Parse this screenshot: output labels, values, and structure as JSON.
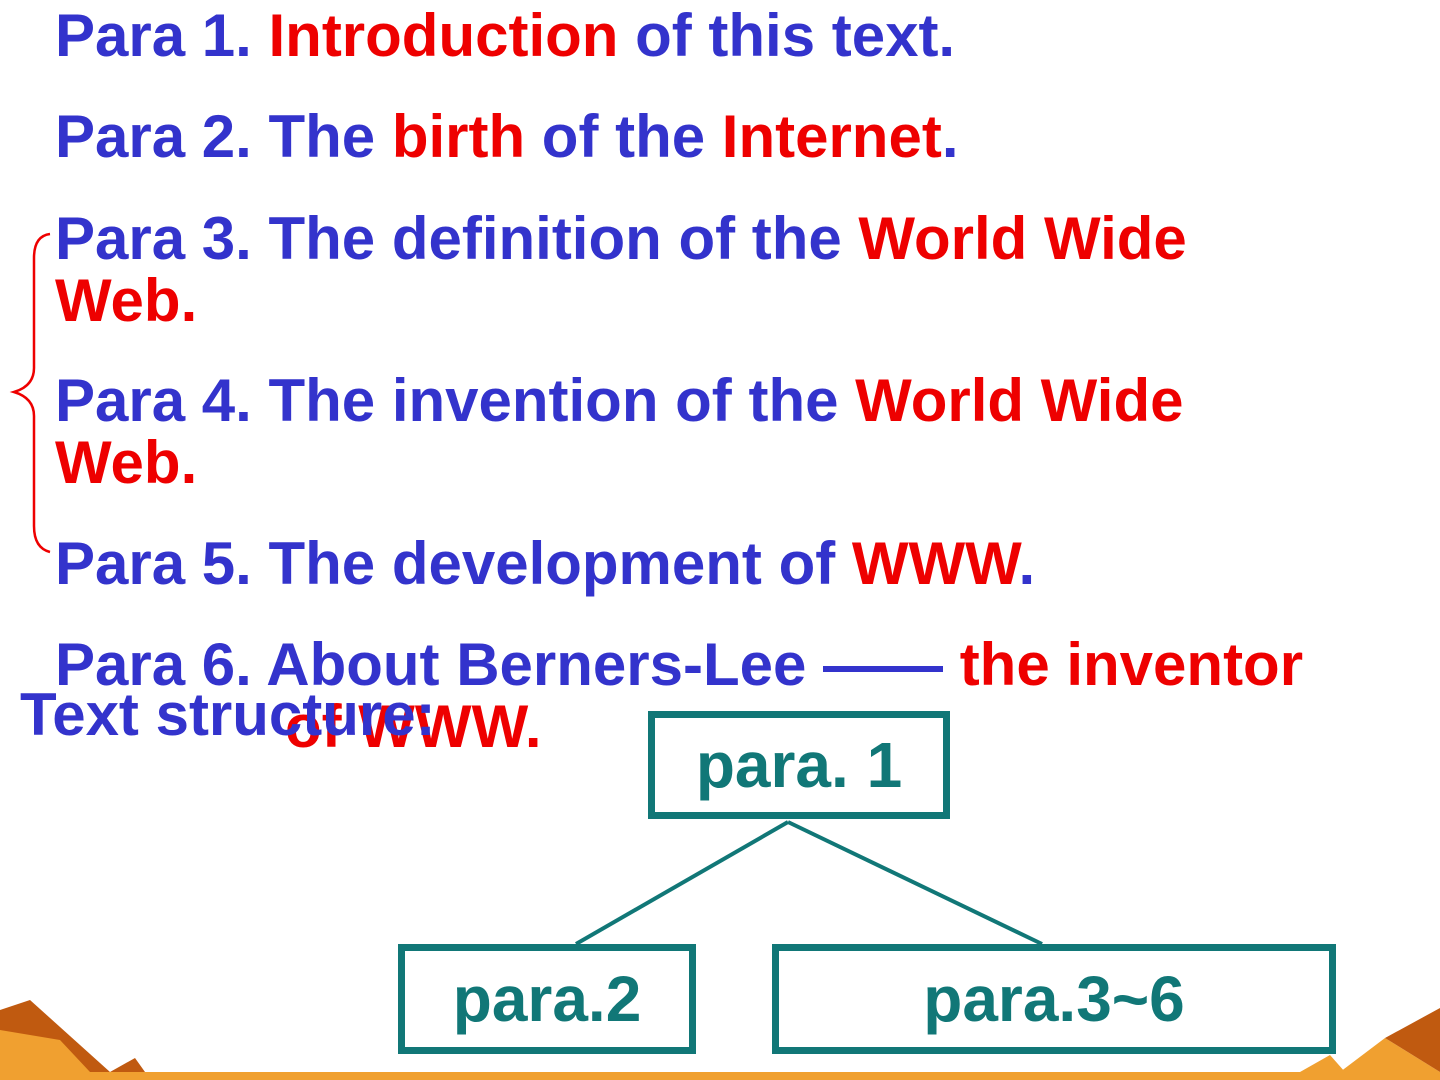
{
  "paragraphs": [
    {
      "id": "p1",
      "segments": [
        {
          "text": "Para 1. ",
          "color": "blue"
        },
        {
          "text": "Introduction",
          "color": "red"
        },
        {
          "text": " of this text.",
          "color": "blue"
        }
      ]
    },
    {
      "id": "p2",
      "segments": [
        {
          "text": "Para 2. The ",
          "color": "blue"
        },
        {
          "text": "birth",
          "color": "red"
        },
        {
          "text": " of the ",
          "color": "blue"
        },
        {
          "text": "Internet",
          "color": "red"
        },
        {
          "text": ".",
          "color": "blue"
        }
      ]
    },
    {
      "id": "p3",
      "line1": [
        {
          "text": "Para 3. The definition of the ",
          "color": "blue"
        },
        {
          "text": "World Wide",
          "color": "red"
        }
      ],
      "line2": [
        {
          "text": "Web.",
          "color": "red"
        }
      ]
    },
    {
      "id": "p4",
      "line1": [
        {
          "text": "Para 4. The invention of the ",
          "color": "blue"
        },
        {
          "text": "World Wide",
          "color": "red"
        }
      ],
      "line2": [
        {
          "text": "Web.",
          "color": "red"
        }
      ]
    },
    {
      "id": "p5",
      "segments": [
        {
          "text": "Para 5. The development of ",
          "color": "blue"
        },
        {
          "text": "WWW",
          "color": "red"
        },
        {
          "text": ".",
          "color": "blue"
        }
      ]
    },
    {
      "id": "p6",
      "line1": [
        {
          "text": "Para 6. About Berners-Lee —— ",
          "color": "blue"
        },
        {
          "text": "the inventor",
          "color": "red"
        }
      ],
      "line2": [
        {
          "text": "of WWW.",
          "color": "red"
        }
      ]
    }
  ],
  "structure": {
    "heading": "Text structure:",
    "root": "para. 1",
    "left_child": "para.2",
    "right_child": "para.3~6"
  },
  "colors": {
    "blue_text": "#3333cc",
    "red_text": "#ee0000",
    "teal": "#117777",
    "brace": "#ee0000",
    "decor_orange": "#f0a030",
    "decor_brown": "#c05a10"
  }
}
